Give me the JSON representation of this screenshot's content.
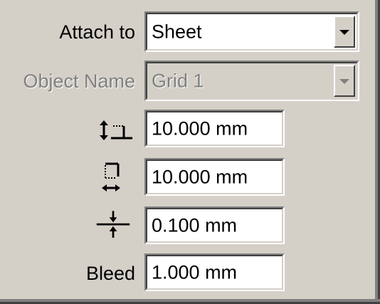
{
  "attach_to": {
    "label": "Attach to",
    "value": "Sheet"
  },
  "object_name": {
    "label": "Object Name",
    "value": "Grid 1"
  },
  "horizontal_spacing": {
    "icon": "horizontal-spacing-icon",
    "value": "10.000 mm"
  },
  "vertical_spacing": {
    "icon": "vertical-spacing-icon",
    "value": "10.000 mm"
  },
  "line_width": {
    "icon": "line-width-icon",
    "value": "0.100 mm"
  },
  "bleed": {
    "label": "Bleed",
    "value": "1.000 mm"
  },
  "colors": {
    "face": "#d4d0c8",
    "disabled_text": "#808080"
  }
}
